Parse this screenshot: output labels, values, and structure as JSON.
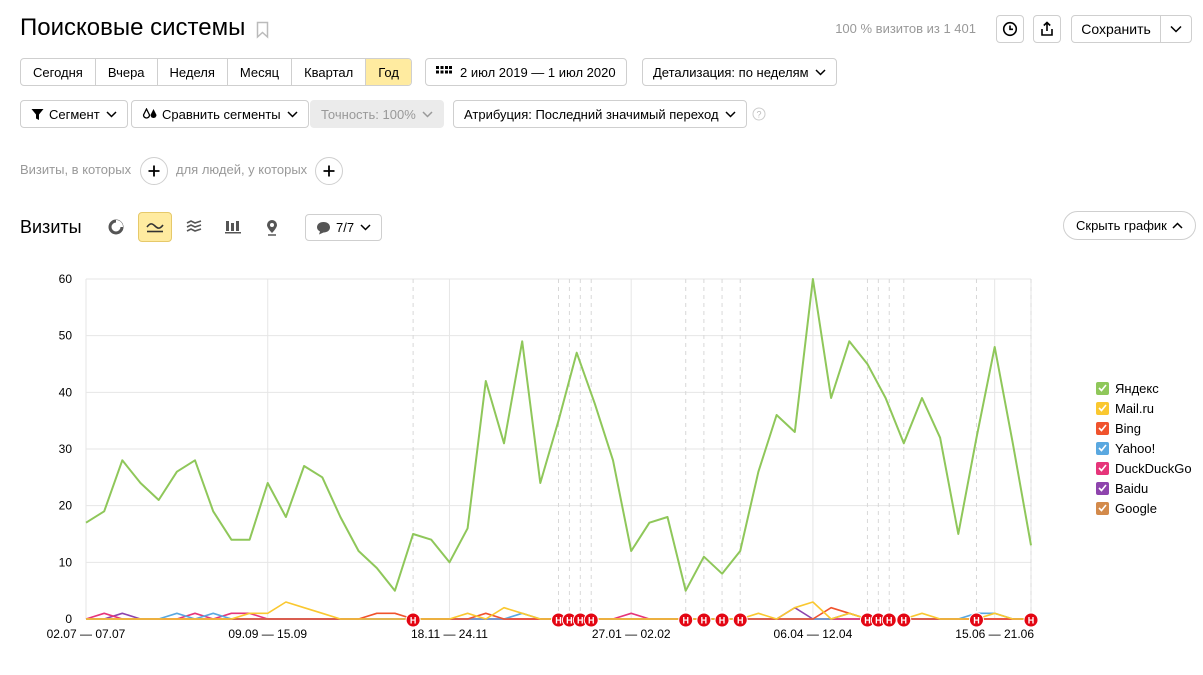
{
  "header": {
    "title": "Поисковые системы",
    "visits_info": "100 % визитов из 1 401",
    "save_label": "Сохранить"
  },
  "period": {
    "buttons": [
      "Сегодня",
      "Вчера",
      "Неделя",
      "Месяц",
      "Квартал",
      "Год"
    ],
    "active_index": 5,
    "date_range": "2 июл 2019 — 1 июл 2020",
    "detail": "Детализация: по неделям"
  },
  "filters": {
    "segment": "Сегмент",
    "compare": "Сравнить сегменты",
    "accuracy": "Точность: 100%",
    "attribution": "Атрибуция: Последний значимый переход",
    "visits_where": "Визиты, в которых",
    "people_where": "для людей, у которых"
  },
  "chart_section": {
    "title": "Визиты",
    "notes_count": "7/7",
    "hide_chart": "Скрыть график"
  },
  "chart_data": {
    "type": "line",
    "ylim": [
      0,
      60
    ],
    "yticks": [
      0,
      10,
      20,
      30,
      40,
      50,
      60
    ],
    "x_tick_labels": [
      {
        "index": 0,
        "label": "02.07 — 07.07"
      },
      {
        "index": 10,
        "label": "09.09 — 15.09"
      },
      {
        "index": 20,
        "label": "18.11 — 24.11"
      },
      {
        "index": 30,
        "label": "27.01 — 02.02"
      },
      {
        "index": 40,
        "label": "06.04 — 12.04"
      },
      {
        "index": 50,
        "label": "15.06 — 21.06"
      }
    ],
    "grid": true,
    "legend_position": "right",
    "annotation_indices": [
      18,
      26,
      26.6,
      27.2,
      27.8,
      33,
      34,
      35,
      36,
      43,
      43.6,
      44.2,
      45,
      49,
      52
    ],
    "annotation_label": "Н",
    "series": [
      {
        "name": "Яндекс",
        "color": "#8fc75a",
        "values": [
          17,
          19,
          28,
          24,
          21,
          26,
          28,
          19,
          14,
          14,
          24,
          18,
          27,
          25,
          18,
          12,
          9,
          5,
          15,
          14,
          10,
          16,
          42,
          31,
          49,
          24,
          35,
          47,
          38,
          28,
          12,
          17,
          18,
          5,
          11,
          8,
          12,
          26,
          36,
          33,
          60,
          39,
          49,
          45,
          39,
          31,
          39,
          32,
          15,
          32,
          48,
          31,
          13
        ]
      },
      {
        "name": "Mail.ru",
        "color": "#fac830",
        "values": [
          0,
          0,
          0,
          0,
          0,
          0,
          0,
          0,
          0,
          1,
          1,
          3,
          2,
          1,
          0,
          0,
          0,
          0,
          0,
          0,
          0,
          1,
          0,
          2,
          1,
          0,
          0,
          0,
          0,
          0,
          0,
          0,
          0,
          0,
          0,
          0,
          0,
          1,
          0,
          2,
          3,
          0,
          1,
          0,
          0,
          0,
          1,
          0,
          0,
          0,
          1,
          0,
          0
        ]
      },
      {
        "name": "Bing",
        "color": "#f0532d",
        "values": [
          0,
          0,
          0,
          0,
          0,
          0,
          0,
          0,
          0,
          0,
          0,
          0,
          0,
          0,
          0,
          0,
          1,
          1,
          0,
          0,
          0,
          0,
          1,
          0,
          0,
          0,
          0,
          0,
          0,
          0,
          0,
          0,
          0,
          0,
          0,
          0,
          0,
          0,
          0,
          0,
          0,
          2,
          1,
          0,
          0,
          0,
          0,
          0,
          0,
          0,
          0,
          0,
          0
        ]
      },
      {
        "name": "Yahoo!",
        "color": "#5aa8e0",
        "values": [
          0,
          0,
          0,
          0,
          0,
          1,
          0,
          1,
          0,
          0,
          0,
          0,
          0,
          0,
          0,
          0,
          0,
          0,
          0,
          0,
          0,
          0,
          0,
          0,
          1,
          0,
          0,
          0,
          0,
          0,
          0,
          0,
          0,
          0,
          0,
          0,
          0,
          0,
          0,
          0,
          0,
          0,
          1,
          0,
          0,
          0,
          0,
          0,
          0,
          1,
          1,
          0,
          0
        ]
      },
      {
        "name": "DuckDuckGo",
        "color": "#e6357a",
        "values": [
          0,
          1,
          0,
          0,
          0,
          0,
          1,
          0,
          1,
          1,
          0,
          0,
          0,
          0,
          0,
          0,
          0,
          0,
          0,
          0,
          0,
          0,
          0,
          0,
          0,
          0,
          0,
          0,
          0,
          0,
          1,
          0,
          0,
          0,
          0,
          0,
          0,
          0,
          0,
          0,
          0,
          0,
          0,
          0,
          0,
          0,
          0,
          0,
          0,
          0,
          0,
          0,
          0
        ]
      },
      {
        "name": "Baidu",
        "color": "#8e44ad",
        "values": [
          0,
          0,
          1,
          0,
          0,
          0,
          0,
          0,
          0,
          0,
          0,
          0,
          0,
          0,
          0,
          0,
          0,
          0,
          0,
          0,
          0,
          0,
          0,
          0,
          0,
          0,
          0,
          0,
          0,
          0,
          0,
          0,
          0,
          0,
          0,
          0,
          0,
          0,
          0,
          2,
          0,
          0,
          0,
          0,
          0,
          0,
          0,
          0,
          0,
          0,
          0,
          0,
          0
        ]
      },
      {
        "name": "Google",
        "color": "#d38a4b",
        "values": [
          0,
          0,
          0,
          0,
          0,
          0,
          0,
          0,
          0,
          0,
          0,
          0,
          0,
          0,
          0,
          0,
          0,
          0,
          0,
          0,
          0,
          0,
          0,
          0,
          0,
          0,
          0,
          0,
          0,
          0,
          0,
          0,
          0,
          0,
          0,
          0,
          0,
          0,
          0,
          0,
          0,
          0,
          0,
          0,
          0,
          0,
          0,
          0,
          0,
          0,
          0,
          0,
          0
        ]
      }
    ]
  }
}
